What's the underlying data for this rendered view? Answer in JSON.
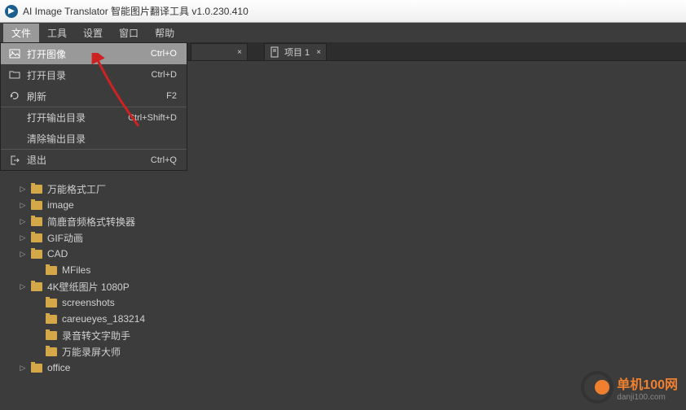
{
  "titlebar": {
    "title": "AI Image Translator 智能图片翻译工具 v1.0.230.410"
  },
  "menubar": {
    "items": [
      {
        "label": "文件",
        "active": true
      },
      {
        "label": "工具",
        "active": false
      },
      {
        "label": "设置",
        "active": false
      },
      {
        "label": "窗口",
        "active": false
      },
      {
        "label": "帮助",
        "active": false
      }
    ]
  },
  "dropdown": {
    "items": [
      {
        "label": "打开图像",
        "shortcut": "Ctrl+O",
        "icon": "image",
        "highlighted": true
      },
      {
        "label": "打开目录",
        "shortcut": "Ctrl+D",
        "icon": "folder",
        "highlighted": false
      },
      {
        "label": "刷新",
        "shortcut": "F2",
        "icon": "refresh",
        "highlighted": false
      },
      {
        "label": "打开输出目录",
        "shortcut": "Ctrl+Shift+D",
        "icon": "",
        "highlighted": false,
        "separator": true
      },
      {
        "label": "清除输出目录",
        "shortcut": "",
        "icon": "",
        "highlighted": false
      },
      {
        "label": "退出",
        "shortcut": "Ctrl+Q",
        "icon": "exit",
        "highlighted": false,
        "separator": true
      }
    ]
  },
  "left_tab": {
    "close": "×"
  },
  "tree": {
    "items": [
      {
        "label": "万能格式工厂",
        "indent": 1,
        "arrow": true
      },
      {
        "label": "image",
        "indent": 1,
        "arrow": true
      },
      {
        "label": "简鹿音频格式转换器",
        "indent": 1,
        "arrow": true
      },
      {
        "label": "GIF动画",
        "indent": 1,
        "arrow": true
      },
      {
        "label": "CAD",
        "indent": 1,
        "arrow": true
      },
      {
        "label": "MFiles",
        "indent": 2,
        "arrow": false
      },
      {
        "label": "4K壁纸图片 1080P",
        "indent": 1,
        "arrow": true
      },
      {
        "label": "screenshots",
        "indent": 2,
        "arrow": false
      },
      {
        "label": "careueyes_183214",
        "indent": 2,
        "arrow": false
      },
      {
        "label": "录音转文字助手",
        "indent": 2,
        "arrow": false
      },
      {
        "label": "万能录屏大师",
        "indent": 2,
        "arrow": false
      },
      {
        "label": "office",
        "indent": 1,
        "arrow": true
      }
    ]
  },
  "right_tab": {
    "icon": "doc",
    "label": "项目 1",
    "close": "×"
  },
  "watermark": {
    "main": "单机100网",
    "sub": "danji100.com"
  }
}
